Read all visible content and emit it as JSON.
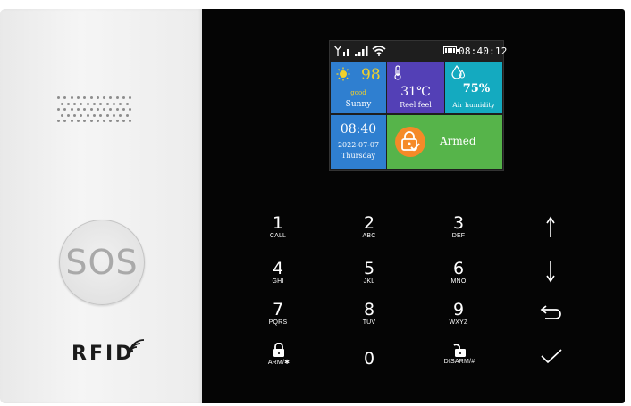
{
  "device": {
    "sos_label": "SOS",
    "rfid_label": "RFID"
  },
  "screen": {
    "status": {
      "clock": "08:40:12"
    },
    "air_quality": {
      "value": "98",
      "quality": "good",
      "weather": "Sunny"
    },
    "temperature": {
      "value": "31℃",
      "label": "Reel feel"
    },
    "humidity": {
      "value": "75%",
      "label": "Air humidity"
    },
    "datetime": {
      "time": "08:40",
      "date": "2022-07-07",
      "day": "Thursday"
    },
    "arm_status": {
      "label": "Armed"
    },
    "colors": {
      "air": "#2f7fd0",
      "temp": "#5340b6",
      "humidity": "#14aac0",
      "armed": "#56b44a",
      "lock": "#f58a28"
    }
  },
  "keypad": {
    "k1": {
      "digit": "1",
      "letters": "CALL"
    },
    "k2": {
      "digit": "2",
      "letters": "ABC"
    },
    "k3": {
      "digit": "3",
      "letters": "DEF"
    },
    "k4": {
      "digit": "4",
      "letters": "GHI"
    },
    "k5": {
      "digit": "5",
      "letters": "JKL"
    },
    "k6": {
      "digit": "6",
      "letters": "MNO"
    },
    "k7": {
      "digit": "7",
      "letters": "PQRS"
    },
    "k8": {
      "digit": "8",
      "letters": "TUV"
    },
    "k9": {
      "digit": "9",
      "letters": "WXYZ"
    },
    "k0": {
      "digit": "0"
    },
    "arm": {
      "label": "ARM/✱"
    },
    "disarm": {
      "label": "DISARM/#"
    }
  },
  "icons": [
    "antenna-signal-icon",
    "cell-signal-icon",
    "wifi-icon",
    "battery-icon",
    "sun-icon",
    "thermometer-icon",
    "droplet-icon",
    "shield-lock-icon",
    "arrow-up-icon",
    "arrow-down-icon",
    "back-arrow-icon",
    "check-icon",
    "lock-icon",
    "unlock-icon",
    "rfid-wave-icon"
  ]
}
